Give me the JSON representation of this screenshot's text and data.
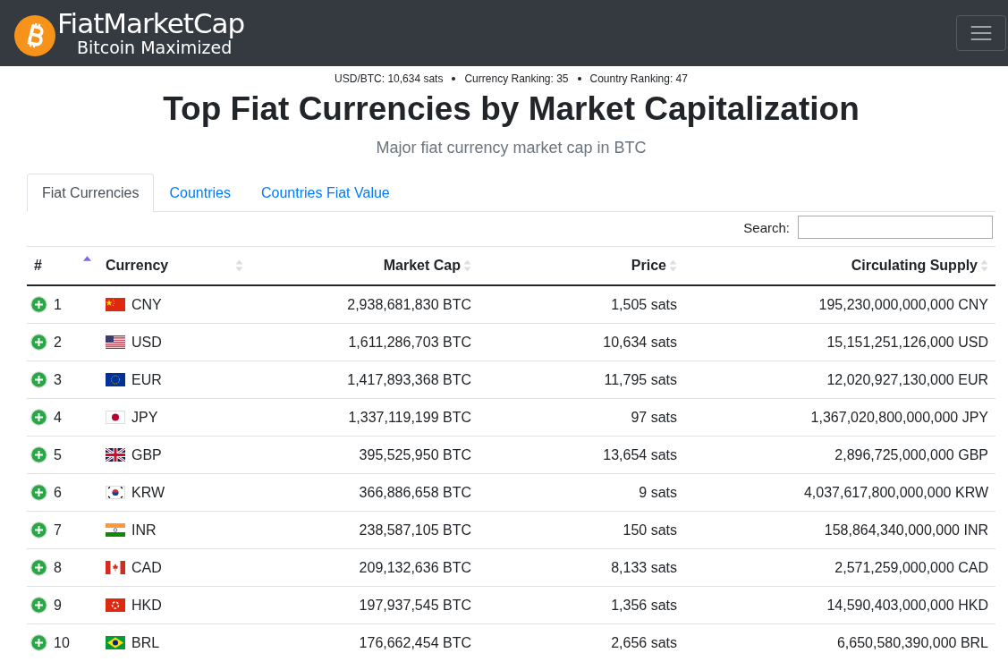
{
  "navbar": {
    "brand": "FiatMarketCap",
    "tagline": "Bitcoin Maximized"
  },
  "stats": [
    "USD/BTC: 10,634 sats",
    "Currency Ranking: 35",
    "Country Ranking: 47"
  ],
  "title": "Top Fiat Currencies by Market Capitalization",
  "subtitle": "Major fiat currency market cap in BTC",
  "tabs": [
    {
      "label": "Fiat Currencies",
      "selected": true
    },
    {
      "label": "Countries",
      "selected": false
    },
    {
      "label": "Countries Fiat Value",
      "selected": false
    }
  ],
  "search": {
    "label": "Search:"
  },
  "table": {
    "columns": [
      {
        "label": "#",
        "sorted": true
      },
      {
        "label": "Currency",
        "sorted": false
      },
      {
        "label": "Market Cap",
        "sorted": false
      },
      {
        "label": "Price",
        "sorted": false
      },
      {
        "label": "Circulating Supply",
        "sorted": false
      }
    ],
    "rows": [
      {
        "rank": "1",
        "kind": "cn",
        "currency": "CNY",
        "market_cap": "2,938,681,830 BTC",
        "price": "1,505 sats",
        "supply": "195,230,000,000,000 CNY"
      },
      {
        "rank": "2",
        "kind": "us",
        "currency": "USD",
        "market_cap": "1,611,286,703 BTC",
        "price": "10,634 sats",
        "supply": "15,151,251,126,000 USD"
      },
      {
        "rank": "3",
        "kind": "eu",
        "currency": "EUR",
        "market_cap": "1,417,893,368 BTC",
        "price": "11,795 sats",
        "supply": "12,020,927,130,000 EUR"
      },
      {
        "rank": "4",
        "kind": "jp",
        "currency": "JPY",
        "market_cap": "1,337,119,199 BTC",
        "price": "97 sats",
        "supply": "1,367,020,800,000,000 JPY"
      },
      {
        "rank": "5",
        "kind": "gb",
        "currency": "GBP",
        "market_cap": "395,525,950 BTC",
        "price": "13,654 sats",
        "supply": "2,896,725,000,000 GBP"
      },
      {
        "rank": "6",
        "kind": "kr",
        "currency": "KRW",
        "market_cap": "366,886,658 BTC",
        "price": "9 sats",
        "supply": "4,037,617,800,000,000 KRW"
      },
      {
        "rank": "7",
        "kind": "in",
        "currency": "INR",
        "market_cap": "238,587,105 BTC",
        "price": "150 sats",
        "supply": "158,864,340,000,000 INR"
      },
      {
        "rank": "8",
        "kind": "ca",
        "currency": "CAD",
        "market_cap": "209,132,636 BTC",
        "price": "8,133 sats",
        "supply": "2,571,259,000,000 CAD"
      },
      {
        "rank": "9",
        "kind": "hk",
        "currency": "HKD",
        "market_cap": "197,937,545 BTC",
        "price": "1,356 sats",
        "supply": "14,590,403,000,000 HKD"
      },
      {
        "rank": "10",
        "kind": "br",
        "currency": "BRL",
        "market_cap": "176,662,454 BTC",
        "price": "2,656 sats",
        "supply": "6,650,580,390,000 BRL"
      }
    ]
  }
}
